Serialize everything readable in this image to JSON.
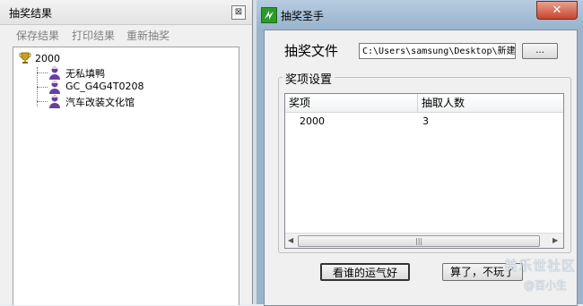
{
  "left_panel": {
    "title": "抽奖结果",
    "close_glyph": "⊠",
    "toolbar": [
      "保存结果",
      "打印结果",
      "重新抽奖"
    ],
    "tree": {
      "root": "2000",
      "items": [
        "无私填鸭",
        "GC_G4G4T0208",
        "汽车改装文化馆"
      ]
    }
  },
  "window": {
    "title": "抽奖圣手",
    "close_glyph": "✕",
    "file_label": "抽奖文件",
    "file_path": "C:\\Users\\samsung\\Desktop\\新建",
    "browse_label": "...",
    "group_title": "奖项设置",
    "table": {
      "headers": [
        "奖项",
        "抽取人数"
      ],
      "rows": [
        [
          "2000",
          "3"
        ]
      ]
    },
    "scroll_grip": "|||",
    "buttons": {
      "lucky": "看谁的运气好",
      "quit": "算了，不玩了"
    }
  },
  "watermark": {
    "line1": "美乐世社区",
    "line2": "@百小生"
  },
  "colors": {
    "titlebar": "#9ab4cd",
    "close_button": "#c8452e",
    "app_icon": "#2a9b2a"
  },
  "icons": {
    "root": "trophy-icon",
    "item": "user-icon",
    "app": "app-icon"
  }
}
